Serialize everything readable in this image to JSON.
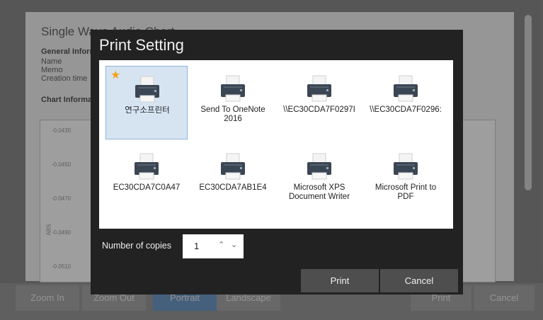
{
  "background": {
    "title": "Single Wave Audio Chart",
    "general_heading": "General Information",
    "fields": [
      "Name",
      "Memo",
      "Creation time"
    ],
    "chart_heading": "Chart Information",
    "y_ticks": [
      "-0.0430",
      "-0.0450",
      "-0.0470",
      "-0.0490",
      "-0.0510"
    ],
    "y_label": "ABS",
    "buttons": {
      "zoom_in": "Zoom In",
      "zoom_out": "Zoom Out",
      "portrait": "Portrait",
      "landscape": "Landscape",
      "print": "Print",
      "cancel": "Cancel"
    }
  },
  "dialog": {
    "title": "Print Setting",
    "printers": [
      {
        "name": "연구소프린터",
        "default": true,
        "selected": true
      },
      {
        "name": "Send To OneNote\n2016"
      },
      {
        "name": "\\\\EC30CDA7F0297I"
      },
      {
        "name": "\\\\EC30CDA7F0296:"
      },
      {
        "name": "EC30CDA7C0A47"
      },
      {
        "name": "EC30CDA7AB1E4"
      },
      {
        "name": "Microsoft XPS\nDocument Writer"
      },
      {
        "name": "Microsoft Print to\nPDF"
      }
    ],
    "copies_label": "Number of copies",
    "copies_value": "1",
    "print_label": "Print",
    "cancel_label": "Cancel"
  },
  "colors": {
    "accent": "#6e9bc9",
    "selected_tile": "#d6e4f2",
    "star": "#f0a21b",
    "dialog_bg": "#222222"
  },
  "icons": {
    "printer": "printer-icon",
    "default": "star-icon",
    "increment": "chevron-up-icon",
    "decrement": "chevron-down-icon"
  }
}
